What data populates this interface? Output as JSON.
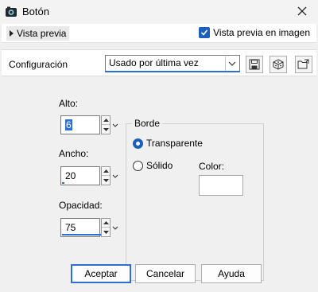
{
  "window": {
    "title": "Botón"
  },
  "preview": {
    "toggle_label": "Vista previa",
    "checkbox_label": "Vista previa en imagen",
    "checkbox_checked": true
  },
  "config": {
    "label": "Configuración",
    "selected": "Usado por última vez"
  },
  "fields": {
    "alto": {
      "label": "Alto:",
      "value": "6"
    },
    "ancho": {
      "label": "Ancho:",
      "value": "20"
    },
    "opacidad": {
      "label": "Opacidad:",
      "value": "75"
    }
  },
  "borde": {
    "title": "Borde",
    "options": [
      {
        "label": "Transparente",
        "selected": true
      },
      {
        "label": "Sólido",
        "selected": false
      }
    ],
    "color_label": "Color:"
  },
  "buttons": {
    "ok": "Aceptar",
    "cancel": "Cancelar",
    "help": "Ayuda"
  },
  "colors": {
    "accent": "#2e6fd3",
    "checkbox": "#1b5fbf"
  },
  "icons": [
    "app-icon",
    "close-icon",
    "caret-right-icon",
    "checkmark-icon",
    "chevron-down-icon",
    "save-icon",
    "dice-icon",
    "folder-icon",
    "spin-up-icon",
    "spin-down-icon"
  ]
}
